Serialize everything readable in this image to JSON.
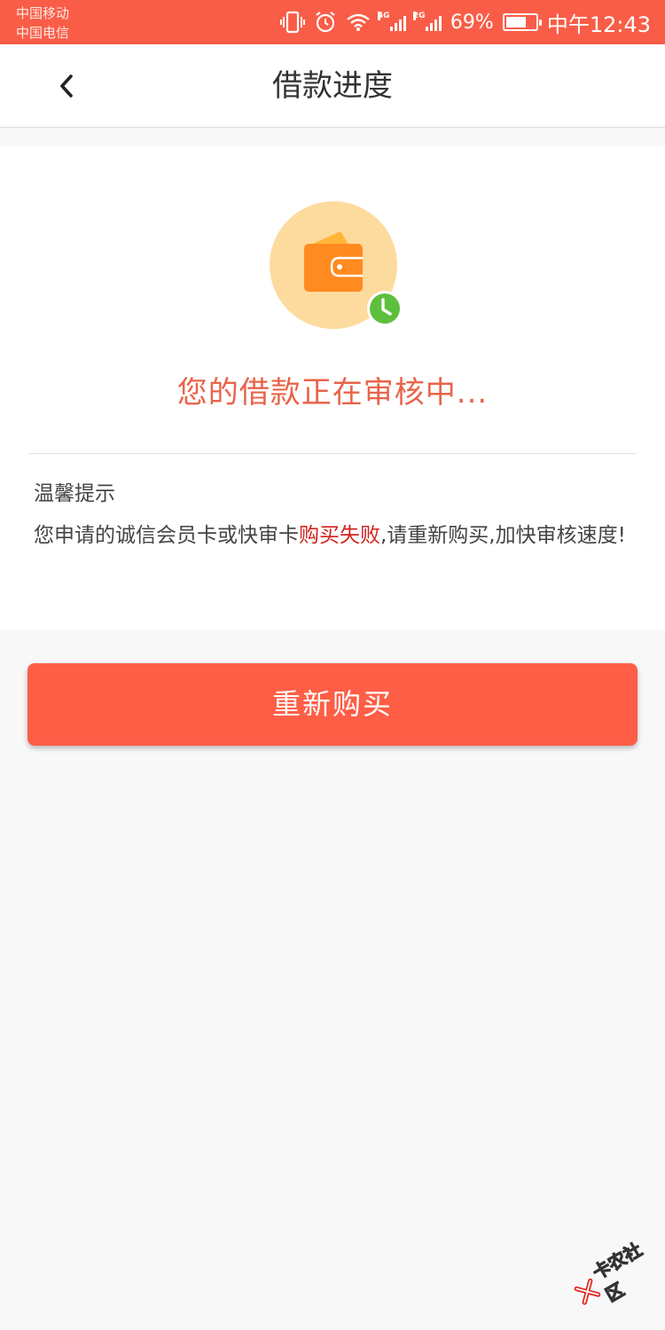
{
  "status_bar": {
    "carrier_1": "中国移动",
    "carrier_2": "中国电信",
    "net_1": "4G",
    "net_2": "2G",
    "battery": "69%",
    "battery_level": 0.69,
    "time": "中午12:43",
    "bg_color": "#f95d47"
  },
  "nav": {
    "title": "借款进度",
    "back_icon": "chevron-left-icon"
  },
  "status": {
    "icon": "wallet-icon",
    "badge_icon": "clock-icon",
    "message": "您的借款正在审核中..."
  },
  "tip": {
    "title": "温馨提示",
    "text_before": "您申请的诚信会员卡或快审卡",
    "text_highlight": "购买失败",
    "text_after": ",请重新购买,加快审核速度!",
    "highlight_color": "#d0231e"
  },
  "button": {
    "label": "重新购买",
    "color": "#fe5e46"
  },
  "watermark": {
    "text": "卡农社区"
  }
}
